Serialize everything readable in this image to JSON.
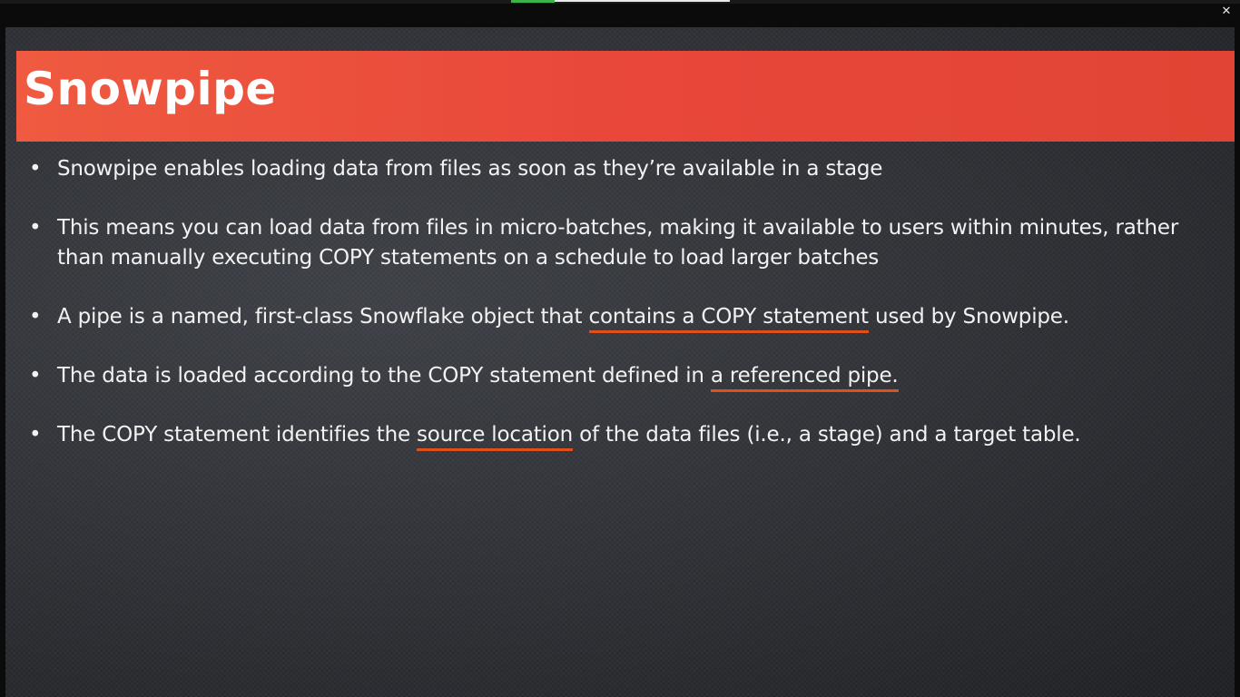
{
  "slide": {
    "title": "Snowpipe",
    "bullets": [
      {
        "text": "Snowpipe enables loading data from files as soon as they’re available in a stage"
      },
      {
        "text": "This means you can load data from files in micro-batches, making it available to users within minutes, rather than manually executing COPY statements on a schedule to load larger batches"
      },
      {
        "before": "A pipe is a named, first-class Snowflake object that ",
        "highlight": "contains a COPY statement",
        "after": " used by Snowpipe."
      },
      {
        "before": "The data is loaded according to the COPY statement defined in ",
        "highlight": "a referenced pipe.",
        "after": ""
      },
      {
        "before": "The COPY statement identifies the ",
        "highlight": "source location",
        "after": " of the data files (i.e., a stage) and a target table."
      }
    ],
    "bullet_char": "•"
  },
  "window": {
    "exit_fullscreen_icon": "✕"
  },
  "colors": {
    "title_bar": "#e8473a",
    "underline": "#e0501c",
    "text": "#f2f2f2"
  }
}
